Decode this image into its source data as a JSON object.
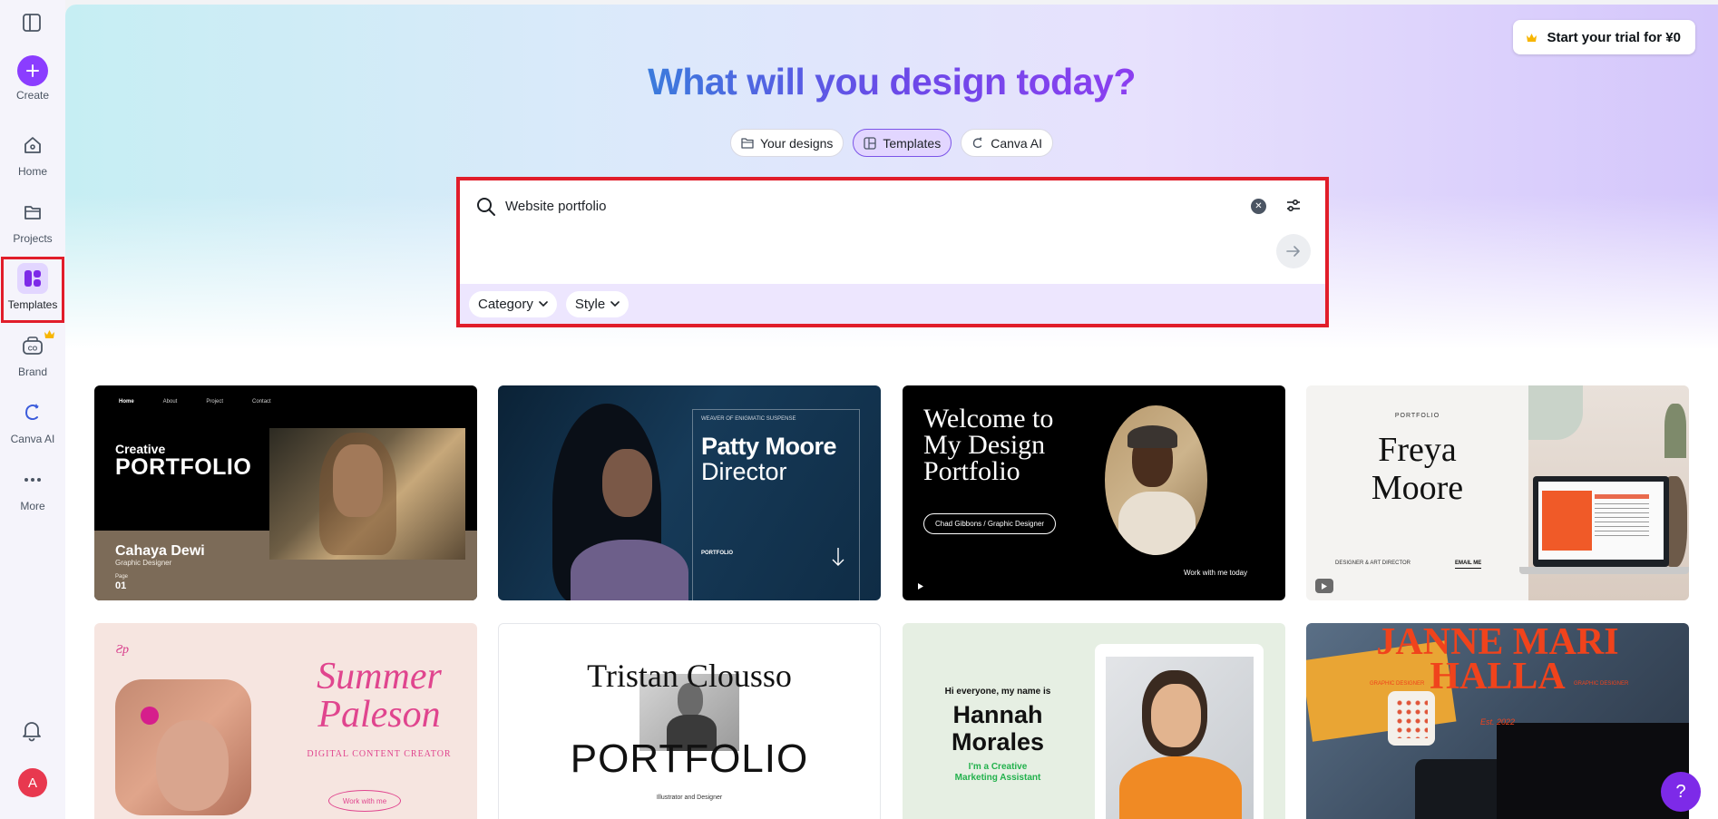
{
  "sidebar": {
    "create_label": "Create",
    "items": [
      {
        "label": "Home",
        "icon": "home-icon"
      },
      {
        "label": "Projects",
        "icon": "folder-icon"
      },
      {
        "label": "Templates",
        "icon": "templates-icon"
      },
      {
        "label": "Brand",
        "icon": "brand-icon"
      },
      {
        "label": "Canva AI",
        "icon": "canva-ai-icon"
      },
      {
        "label": "More",
        "icon": "more-icon"
      }
    ],
    "avatar_initial": "A"
  },
  "header": {
    "trial_label": "Start your trial for ¥0",
    "title": "What will you design today?"
  },
  "chips": {
    "your_designs": "Your designs",
    "templates": "Templates",
    "canva_ai": "Canva AI"
  },
  "search": {
    "value": "Website portfolio",
    "category_label": "Category",
    "style_label": "Style"
  },
  "templates": [
    {
      "nav": [
        "Home",
        "About",
        "Project",
        "Contact"
      ],
      "title_small": "Creative",
      "title_big": "PORTFOLIO",
      "name": "Cahaya Dewi",
      "role": "Graphic Designer",
      "page_label": "Page",
      "page_num": "01"
    },
    {
      "tagline": "WEAVER OF ENIGMATIC SUSPENSE",
      "name": "Patty Moore",
      "role": "Director",
      "label": "PORTFOLIO"
    },
    {
      "line1": "Welcome to",
      "line2": "My Design",
      "line3": "Portfolio",
      "badge": "Chad Gibbons / Graphic Designer",
      "cta": "Work with me today"
    },
    {
      "label": "PORTFOLIO",
      "first": "Freya",
      "last": "Moore",
      "role": "DESIGNER & ART DIRECTOR",
      "cta": "EMAIL ME"
    },
    {
      "first": "Summer",
      "last": "Paleson",
      "role": "DIGITAL CONTENT CREATOR",
      "cta": "Work with me"
    },
    {
      "name": "Tristan Clousso",
      "big": "PORTFOLIO",
      "role": "Illustrator and Designer"
    },
    {
      "intro": "Hi everyone, my name is",
      "first": "Hannah",
      "last": "Morales",
      "tag1": "I'm a Creative",
      "tag2": "Marketing Assistant"
    },
    {
      "line1": "JANNE MARI",
      "line2": "HALLA",
      "left": "GRAPHIC DESIGNER",
      "right": "GRAPHIC DESIGNER",
      "est": "Est. 2022"
    }
  ],
  "help_label": "?"
}
